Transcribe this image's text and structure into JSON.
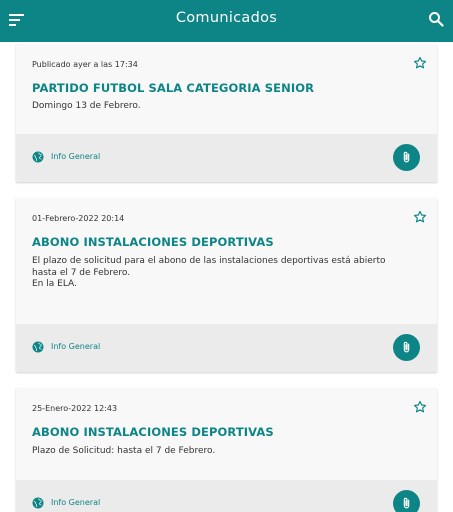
{
  "header": {
    "title": "Comunicados"
  },
  "colors": {
    "primary": "#0d8586",
    "card_bg": "#f8f8f8",
    "footer_bg": "#ebebeb"
  },
  "icons": {
    "menu": "menu-icon",
    "search": "search-icon",
    "favorite": "star-outline-icon",
    "category": "globe-icon",
    "attachment": "paperclip-icon"
  },
  "posts": [
    {
      "date": "Publicado ayer a las 17:34",
      "title": "PARTIDO FUTBOL SALA CATEGORIA SENIOR",
      "body": "Domingo 13 de Febrero.",
      "category": "Info General"
    },
    {
      "date": "01-Febrero-2022 20:14",
      "title": "ABONO INSTALACIONES DEPORTIVAS",
      "body": "El plazo de solicitud para el abono de las instalaciones deportivas está abierto\nhasta el 7 de Febrero.\nEn la ELA.",
      "category": "Info General"
    },
    {
      "date": "25-Enero-2022 12:43",
      "title": "ABONO INSTALACIONES DEPORTIVAS",
      "body": "Plazo de Solicitud: hasta el 7 de Febrero.",
      "category": "Info General"
    }
  ]
}
